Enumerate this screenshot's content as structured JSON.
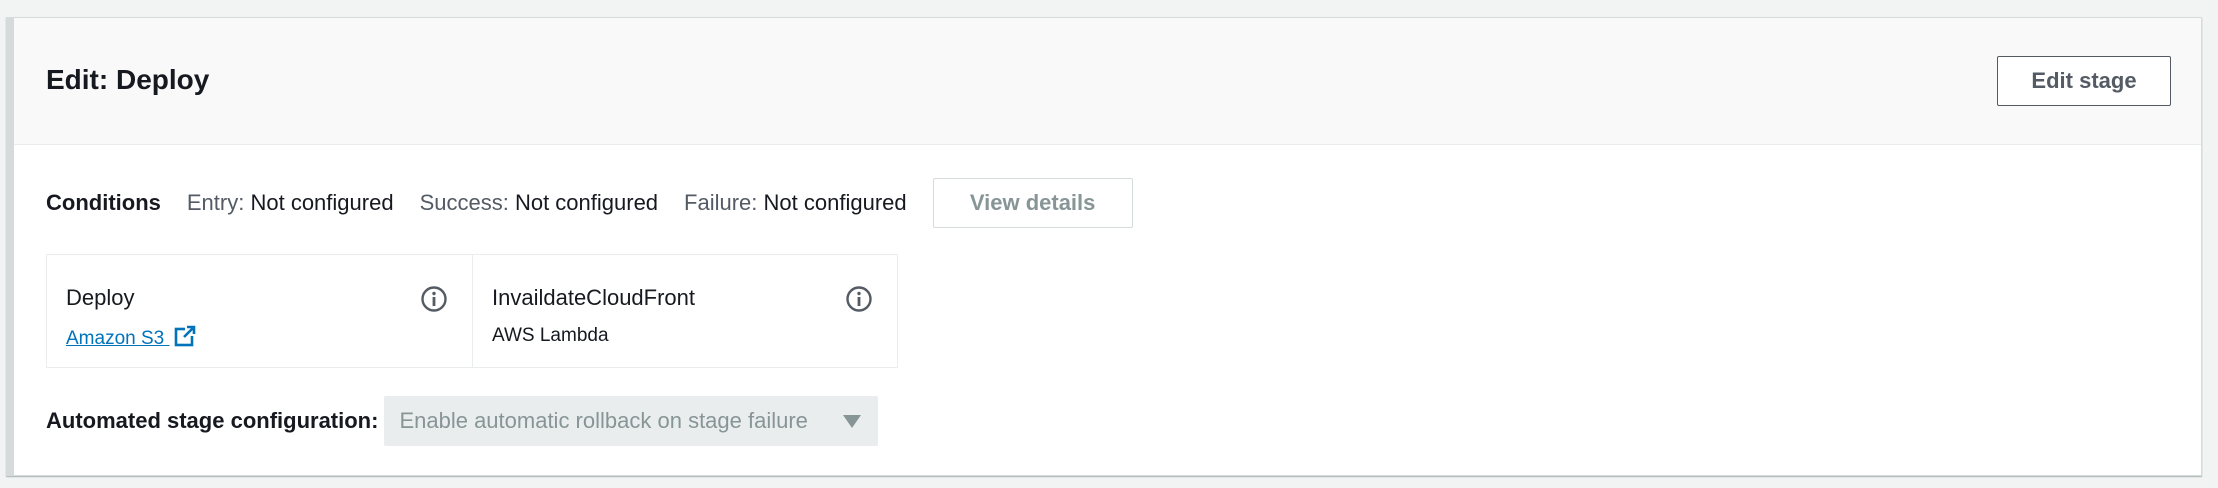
{
  "stage": {
    "title": "Edit: Deploy",
    "edit_button_label": "Edit stage"
  },
  "conditions": {
    "label": "Conditions",
    "items": [
      {
        "key": "Entry:",
        "value": "Not configured"
      },
      {
        "key": "Success:",
        "value": "Not configured"
      },
      {
        "key": "Failure:",
        "value": "Not configured"
      }
    ],
    "view_details_label": "View details"
  },
  "actions": [
    {
      "name": "Deploy",
      "provider": "Amazon S3",
      "provider_is_link": true,
      "icon": "info-icon"
    },
    {
      "name": "InvaildateCloudFront",
      "provider": "AWS Lambda",
      "provider_is_link": false,
      "icon": "info-icon"
    }
  ],
  "automated": {
    "label": "Automated stage configuration:",
    "select_value": "Enable automatic rollback on stage failure"
  },
  "colors": {
    "link": "#0073bb",
    "text": "#16191f",
    "muted": "#879596",
    "border": "#d5dbdb"
  }
}
